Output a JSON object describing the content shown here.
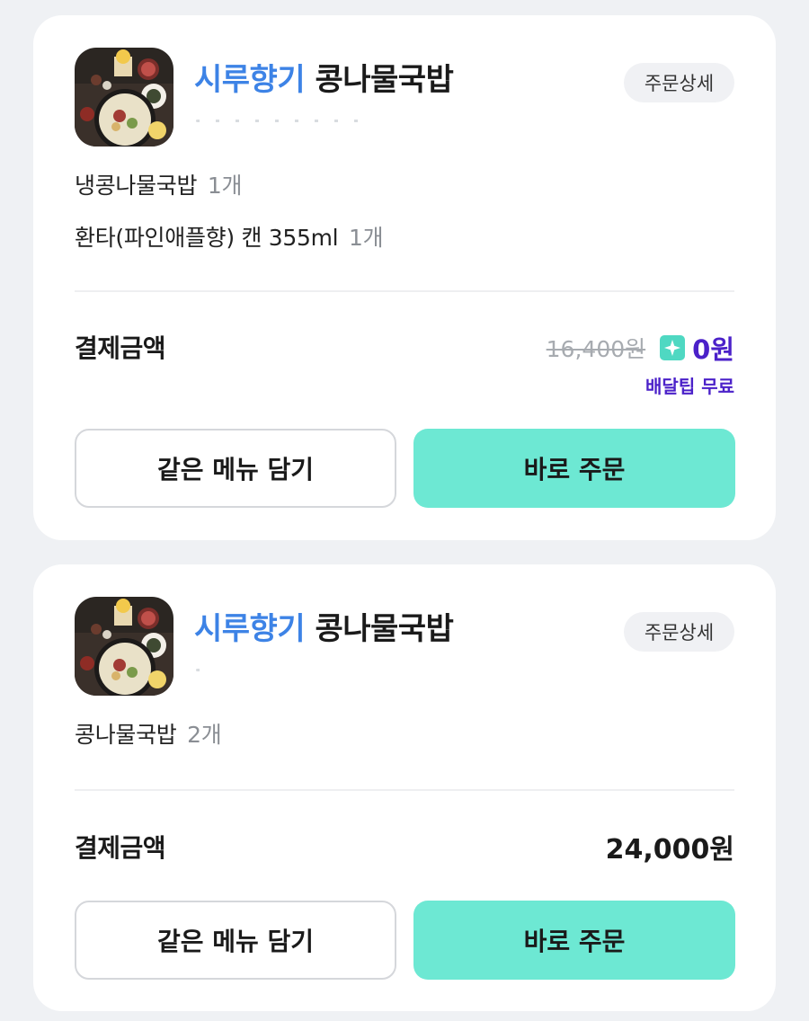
{
  "orders": [
    {
      "store": {
        "brand": "시루향기",
        "name": "콩나물국밥"
      },
      "detail_button": "주문상세",
      "items": [
        {
          "name": "냉콩나물국밥",
          "qty": "1개"
        },
        {
          "name": "환타(파인애플향) 캔 355ml",
          "qty": "1개"
        }
      ],
      "payment": {
        "label": "결제금액",
        "original_price": "16,400원",
        "price": "0원",
        "note": "배달팁 무료"
      },
      "buttons": {
        "reorder_same": "같은 메뉴 담기",
        "order_now": "바로 주문"
      }
    },
    {
      "store": {
        "brand": "시루향기",
        "name": "콩나물국밥"
      },
      "detail_button": "주문상세",
      "items": [
        {
          "name": "콩나물국밥",
          "qty": "2개"
        }
      ],
      "payment": {
        "label": "결제금액",
        "price": "24,000원"
      },
      "buttons": {
        "reorder_same": "같은 메뉴 담기",
        "order_now": "바로 주문"
      }
    }
  ],
  "colors": {
    "brand_text": "#3d83e6",
    "primary_button": "#6de8d3",
    "discount_text": "#4b21c9",
    "star_badge": "#4fd8c2"
  },
  "icons": {
    "discount_badge": "sparkle-icon",
    "store_thumbnail": "food-thumbnail"
  }
}
